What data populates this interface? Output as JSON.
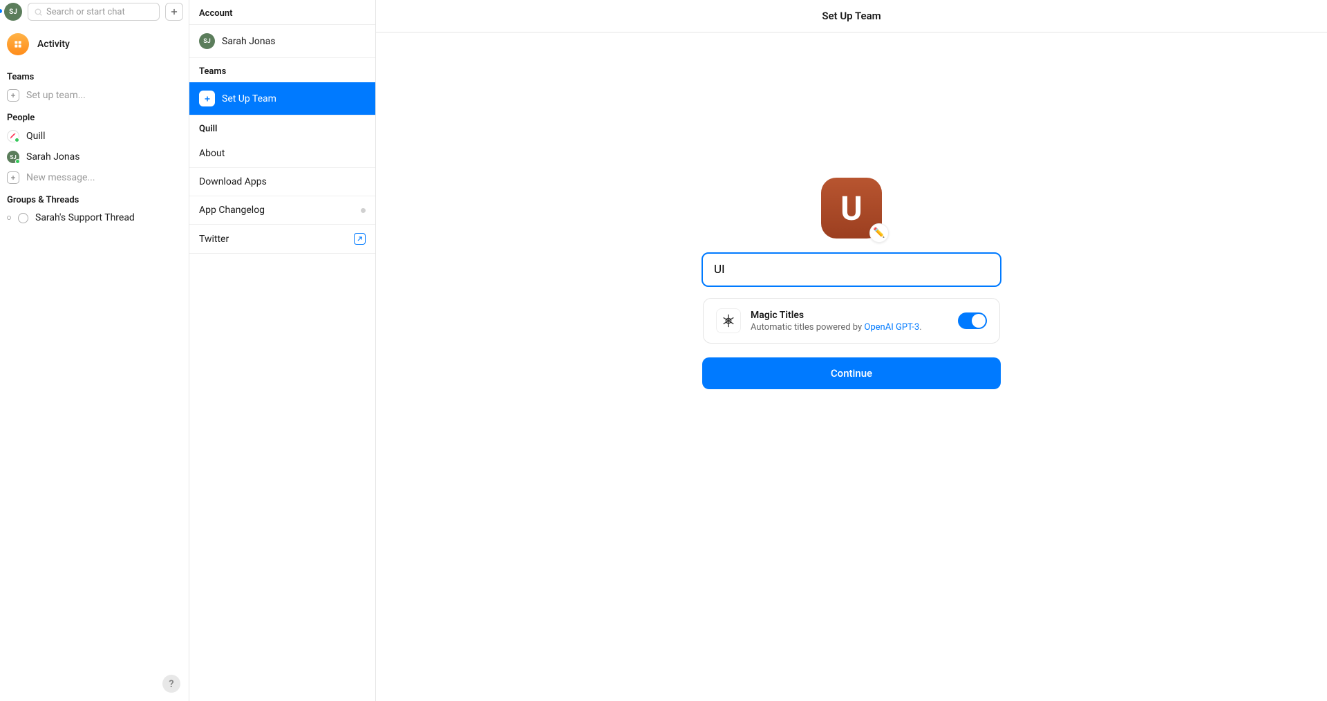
{
  "topbar": {
    "user_initials": "SJ",
    "search_placeholder": "Search or start chat"
  },
  "activity": {
    "label": "Activity"
  },
  "sidebar": {
    "teams_header": "Teams",
    "setup_team": "Set up team...",
    "people_header": "People",
    "quill": "Quill",
    "sarah": "Sarah Jonas",
    "new_message": "New message...",
    "groups_header": "Groups & Threads",
    "support_thread": "Sarah's Support Thread"
  },
  "settings": {
    "account_header": "Account",
    "account_name": "Sarah Jonas",
    "account_initials": "SJ",
    "teams_header": "Teams",
    "setup_team": "Set Up Team",
    "quill_header": "Quill",
    "about": "About",
    "download": "Download Apps",
    "changelog": "App Changelog",
    "twitter": "Twitter"
  },
  "main": {
    "title": "Set Up Team",
    "team_letter": "U",
    "edit_emoji": "✏️",
    "team_name_value": "UI",
    "magic_title": "Magic Titles",
    "magic_subtitle_prefix": "Automatic titles powered by ",
    "magic_link": "OpenAI GPT-3",
    "magic_period": ".",
    "continue": "Continue"
  },
  "help": {
    "label": "?"
  }
}
